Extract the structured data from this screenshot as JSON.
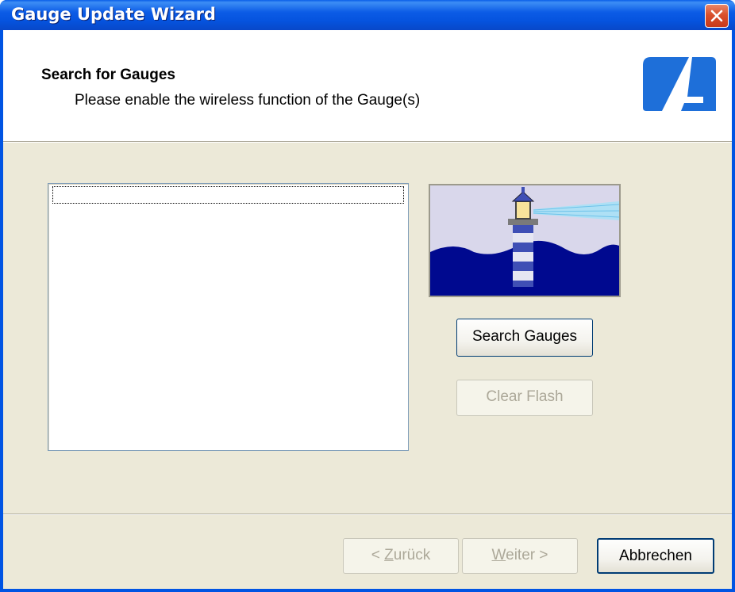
{
  "window": {
    "title": "Gauge Update Wizard"
  },
  "header": {
    "title": "Search for Gauges",
    "subtitle": "Please enable the wireless function of the Gauge(s)",
    "logo_icon": "brand-logo-icon"
  },
  "gauge_list": {
    "items": []
  },
  "illustration": {
    "icon": "lighthouse-icon"
  },
  "actions": {
    "search_label": "Search Gauges",
    "clear_label": "Clear Flash",
    "clear_enabled": false
  },
  "footer": {
    "back_label_prefix": "< ",
    "back_label_mnemonic": "Z",
    "back_label_rest": "urück",
    "back_enabled": false,
    "next_label_mnemonic": "W",
    "next_label_rest": "eiter >",
    "next_enabled": false,
    "cancel_label": "Abbrechen"
  },
  "colors": {
    "titlebar": "#0054e3",
    "dialog_bg": "#ece9d8",
    "logo_blue": "#1e6fd9",
    "sea": "#00098f"
  }
}
